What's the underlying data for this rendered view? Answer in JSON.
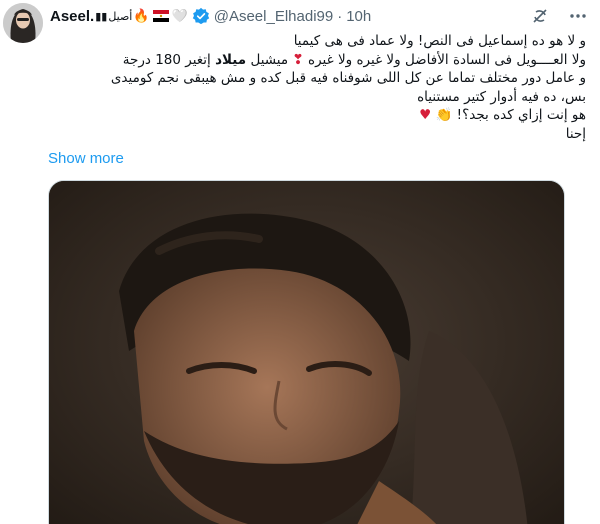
{
  "tweet": {
    "author_name": "Aseel.",
    "author_name_suffix": "أصيل",
    "handle": "@Aseel_Elhadi99",
    "separator": "·",
    "time": "10h",
    "lines": [
      "و لا هو ده إسماعيل فى النص! ولا عماد فى هى كيميا",
      "ولا العــــويل فى السادة الأفاضل ولا غيره ولا غيره",
      "و عامل دور مختلف تماما عن كل اللى شوفناه فيه قبل كده و مش هيبقى نجم كوميدى",
      "بس، ده فيه أدوار كتير مستنياه",
      "هو إنت إزاي كده بجد؟!",
      "إحنا"
    ],
    "line2_tail_prefix": "ميشيل",
    "line2_tail_bold": "ميلاد",
    "line2_tail_suffix": "إتغير 180 درجة",
    "show_more": "Show more"
  },
  "icons": {
    "verified": "verified-badge-icon",
    "grok": "grok-icon",
    "more": "more-icon"
  },
  "colors": {
    "link": "#1d9bf0",
    "secondary_text": "#536471",
    "verified": "#1d9bf0"
  }
}
